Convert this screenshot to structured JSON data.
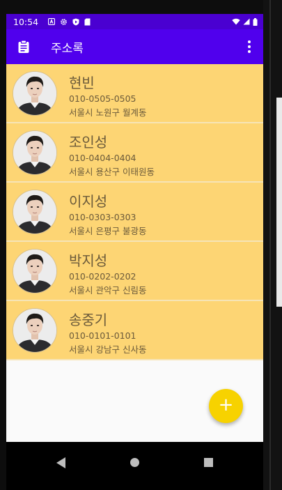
{
  "status_bar": {
    "time": "10:54",
    "left_icons": [
      "a-icon",
      "gear-icon",
      "play-protect-icon",
      "sd-card-icon"
    ],
    "right_icons": [
      "wifi-icon",
      "signal-icon",
      "battery-icon"
    ]
  },
  "app_bar": {
    "icon": "clipboard-icon",
    "title": "주소록",
    "menu_icon": "more-vert-icon"
  },
  "contacts": [
    {
      "name": "현빈",
      "phone": "010-0505-0505",
      "address": "서울시 노원구 월계동"
    },
    {
      "name": "조인성",
      "phone": "010-0404-0404",
      "address": "서울시 용산구 이태원동"
    },
    {
      "name": "이지성",
      "phone": "010-0303-0303",
      "address": "서울시 은평구 불광동"
    },
    {
      "name": "박지성",
      "phone": "010-0202-0202",
      "address": "서울시 관악구 신림동"
    },
    {
      "name": "송중기",
      "phone": "010-0101-0101",
      "address": "서울시 강남구 신사동"
    }
  ],
  "fab": {
    "label": "+",
    "icon": "add-icon"
  },
  "nav_bar": {
    "icons": [
      "back-icon",
      "home-icon",
      "recents-icon"
    ]
  },
  "colors": {
    "app_bar": "#5000ed",
    "status_bar": "#4a00d1",
    "row_background": "#fdd574",
    "fab": "#f7d200"
  }
}
